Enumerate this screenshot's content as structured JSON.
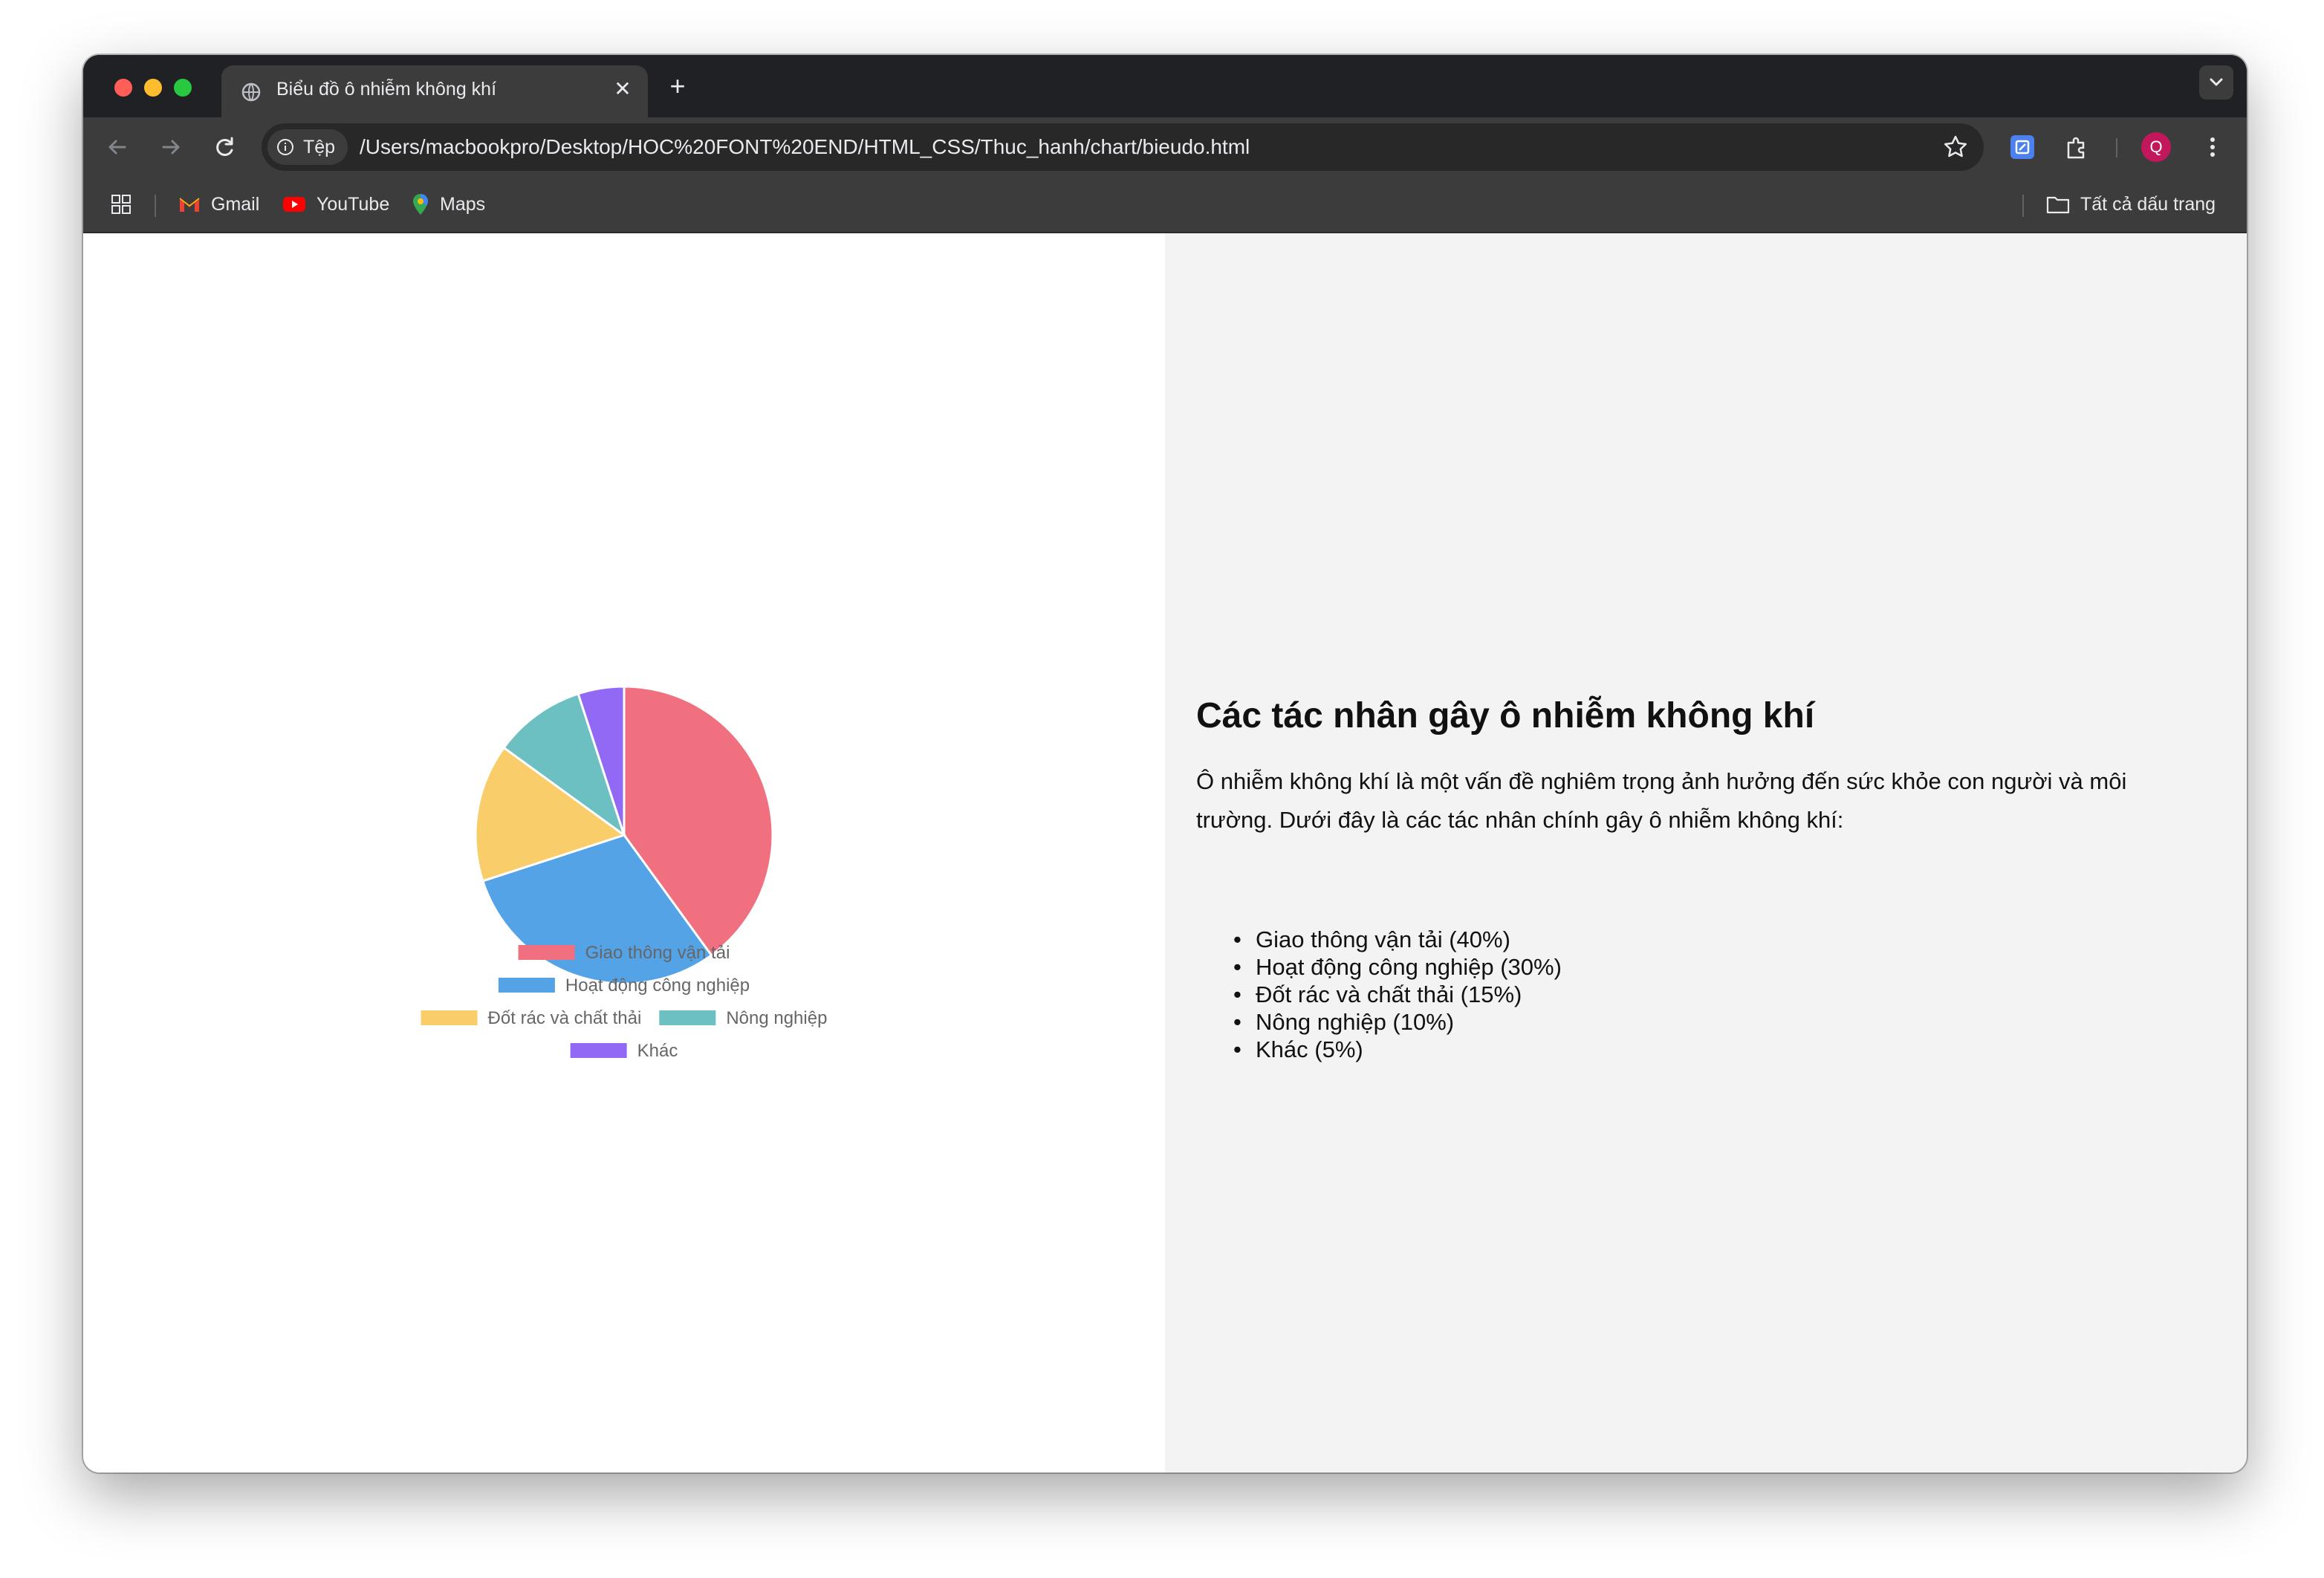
{
  "browser": {
    "tab_title": "Biểu đồ ô nhiễm không khí",
    "chip_label": "Tệp",
    "url": "/Users/macbookpro/Desktop/HOC%20FONT%20END/HTML_CSS/Thuc_hanh/chart/bieudo.html",
    "avatar_letter": "Q",
    "bookmarks": {
      "gmail": "Gmail",
      "youtube": "YouTube",
      "maps": "Maps",
      "all_bookmarks": "Tất cả dấu trang"
    }
  },
  "page": {
    "heading": "Các tác nhân gây ô nhiễm không khí",
    "paragraph": "Ô nhiễm không khí là một vấn đề nghiêm trọng ảnh hưởng đến sức khỏe con người và môi trường. Dưới đây là các tác nhân chính gây ô nhiễm không khí:",
    "list": [
      "Giao thông vận tải (40%)",
      "Hoạt động công nghiệp (30%)",
      "Đốt rác và chất thải (15%)",
      "Nông nghiệp (10%)",
      "Khác (5%)"
    ]
  },
  "chart_data": {
    "type": "pie",
    "categories": [
      "Giao thông vận tải",
      "Hoạt động công nghiệp",
      "Đốt rác và chất thải",
      "Nông nghiệp",
      "Khác"
    ],
    "values": [
      40,
      30,
      15,
      10,
      5
    ],
    "colors": [
      "#f0707f",
      "#54a3e6",
      "#f8cd6a",
      "#6cc0c1",
      "#9169f5"
    ],
    "legend_position": "bottom"
  }
}
